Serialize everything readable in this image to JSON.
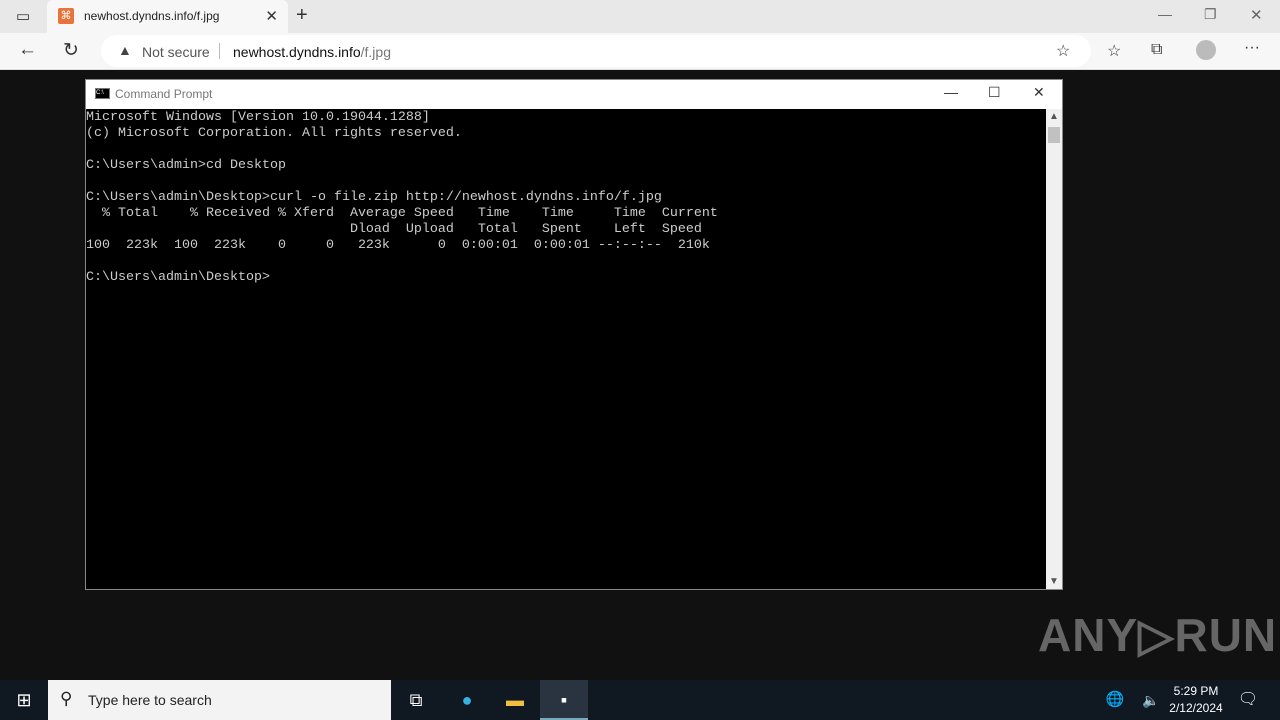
{
  "browser": {
    "tab_title": "newhost.dyndns.info/f.jpg",
    "security_label": "Not secure",
    "url_host": "newhost.dyndns.info",
    "url_path": "/f.jpg"
  },
  "window": {
    "title": "Command Prompt"
  },
  "console": {
    "lines": [
      "Microsoft Windows [Version 10.0.19044.1288]",
      "(c) Microsoft Corporation. All rights reserved.",
      "",
      "C:\\Users\\admin>cd Desktop",
      "",
      "C:\\Users\\admin\\Desktop>curl -o file.zip http://newhost.dyndns.info/f.jpg",
      "  % Total    % Received % Xferd  Average Speed   Time    Time     Time  Current",
      "                                 Dload  Upload   Total   Spent    Left  Speed",
      "100  223k  100  223k    0     0   223k      0  0:00:01  0:00:01 --:--:--  210k",
      "",
      "C:\\Users\\admin\\Desktop>"
    ]
  },
  "watermark": "ANY RUN",
  "taskbar": {
    "search_placeholder": "Type here to search",
    "time": "5:29 PM",
    "date": "2/12/2024"
  }
}
